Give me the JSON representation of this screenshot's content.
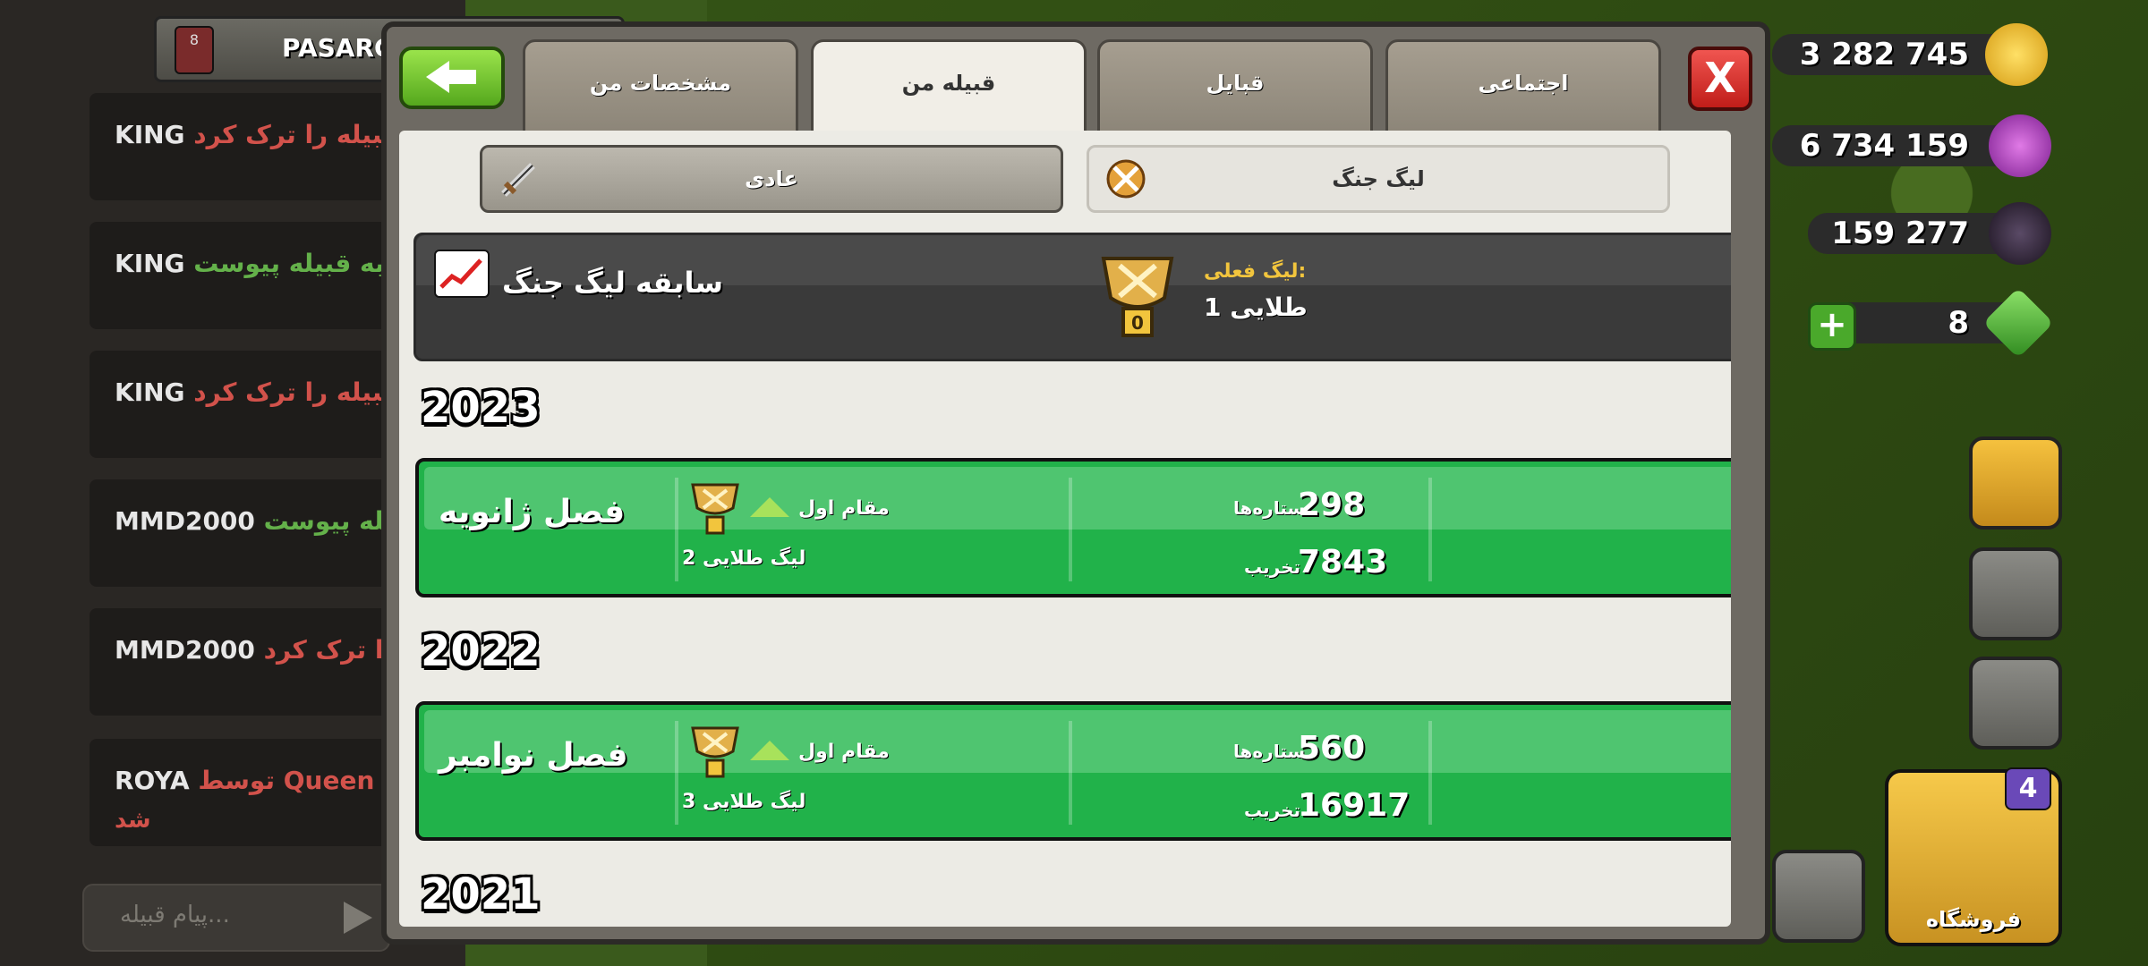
{
  "chat": {
    "clan_name": "PASARG",
    "clan_level": "8",
    "input_placeholder": "پیام قبیله...",
    "messages": [
      {
        "name": "KING",
        "text": "قبیله را ترک کرد",
        "tone": "red"
      },
      {
        "name": "KING",
        "text": "به قبیله پیوست",
        "tone": "green"
      },
      {
        "name": "KING",
        "text": "قبیله را ترک کرد",
        "tone": "red"
      },
      {
        "name": "MMD2000",
        "text": "قبیله پیوست",
        "tone": "green"
      },
      {
        "name": "MMD2000",
        "text": "له را ترک کرد",
        "tone": "red"
      },
      {
        "name": "ROYA",
        "text": "توسط Queen Par",
        "line2": "شد",
        "tone": "red"
      }
    ]
  },
  "hud": {
    "gold": "3 282 745",
    "elixir": "6 734 159",
    "dark_elixir": "159 277",
    "gems": "8",
    "shop_label": "فروشگاه",
    "shop_badge": "4"
  },
  "modal": {
    "tabs": [
      {
        "label": "مشخصات من",
        "active": false
      },
      {
        "label": "قبیله من",
        "active": true
      },
      {
        "label": "قبایل",
        "active": false
      },
      {
        "label": "اجتماعی",
        "active": false
      }
    ],
    "close_label": "X",
    "subtabs": {
      "normal": "عادی",
      "war_league": "لیگ جنگ"
    },
    "summary": {
      "title": "سابقه لیگ جنگ",
      "current_league_label": "لیگ فعلی:",
      "current_league_value": "طلایی 1",
      "trophy_number": "0"
    },
    "history": [
      {
        "year": "2023",
        "season": "فصل ژانویه",
        "rank": "مقام اول",
        "league": "لیگ طلایی 2",
        "stars": "298",
        "stars_label": "ستاره‌ها",
        "destruction": "7843",
        "destruction_label": "تخریب"
      },
      {
        "year": "2022",
        "season": "فصل نوامبر",
        "rank": "مقام اول",
        "league": "لیگ طلایی 3",
        "stars": "560",
        "stars_label": "ستاره‌ها",
        "destruction": "16917",
        "destruction_label": "تخریب"
      },
      {
        "year": "2021"
      }
    ]
  },
  "colors": {
    "season_green": "#21b24a",
    "gold_text": "#f2c53d",
    "chat_red": "#d2524b",
    "chat_green": "#64b14a"
  }
}
